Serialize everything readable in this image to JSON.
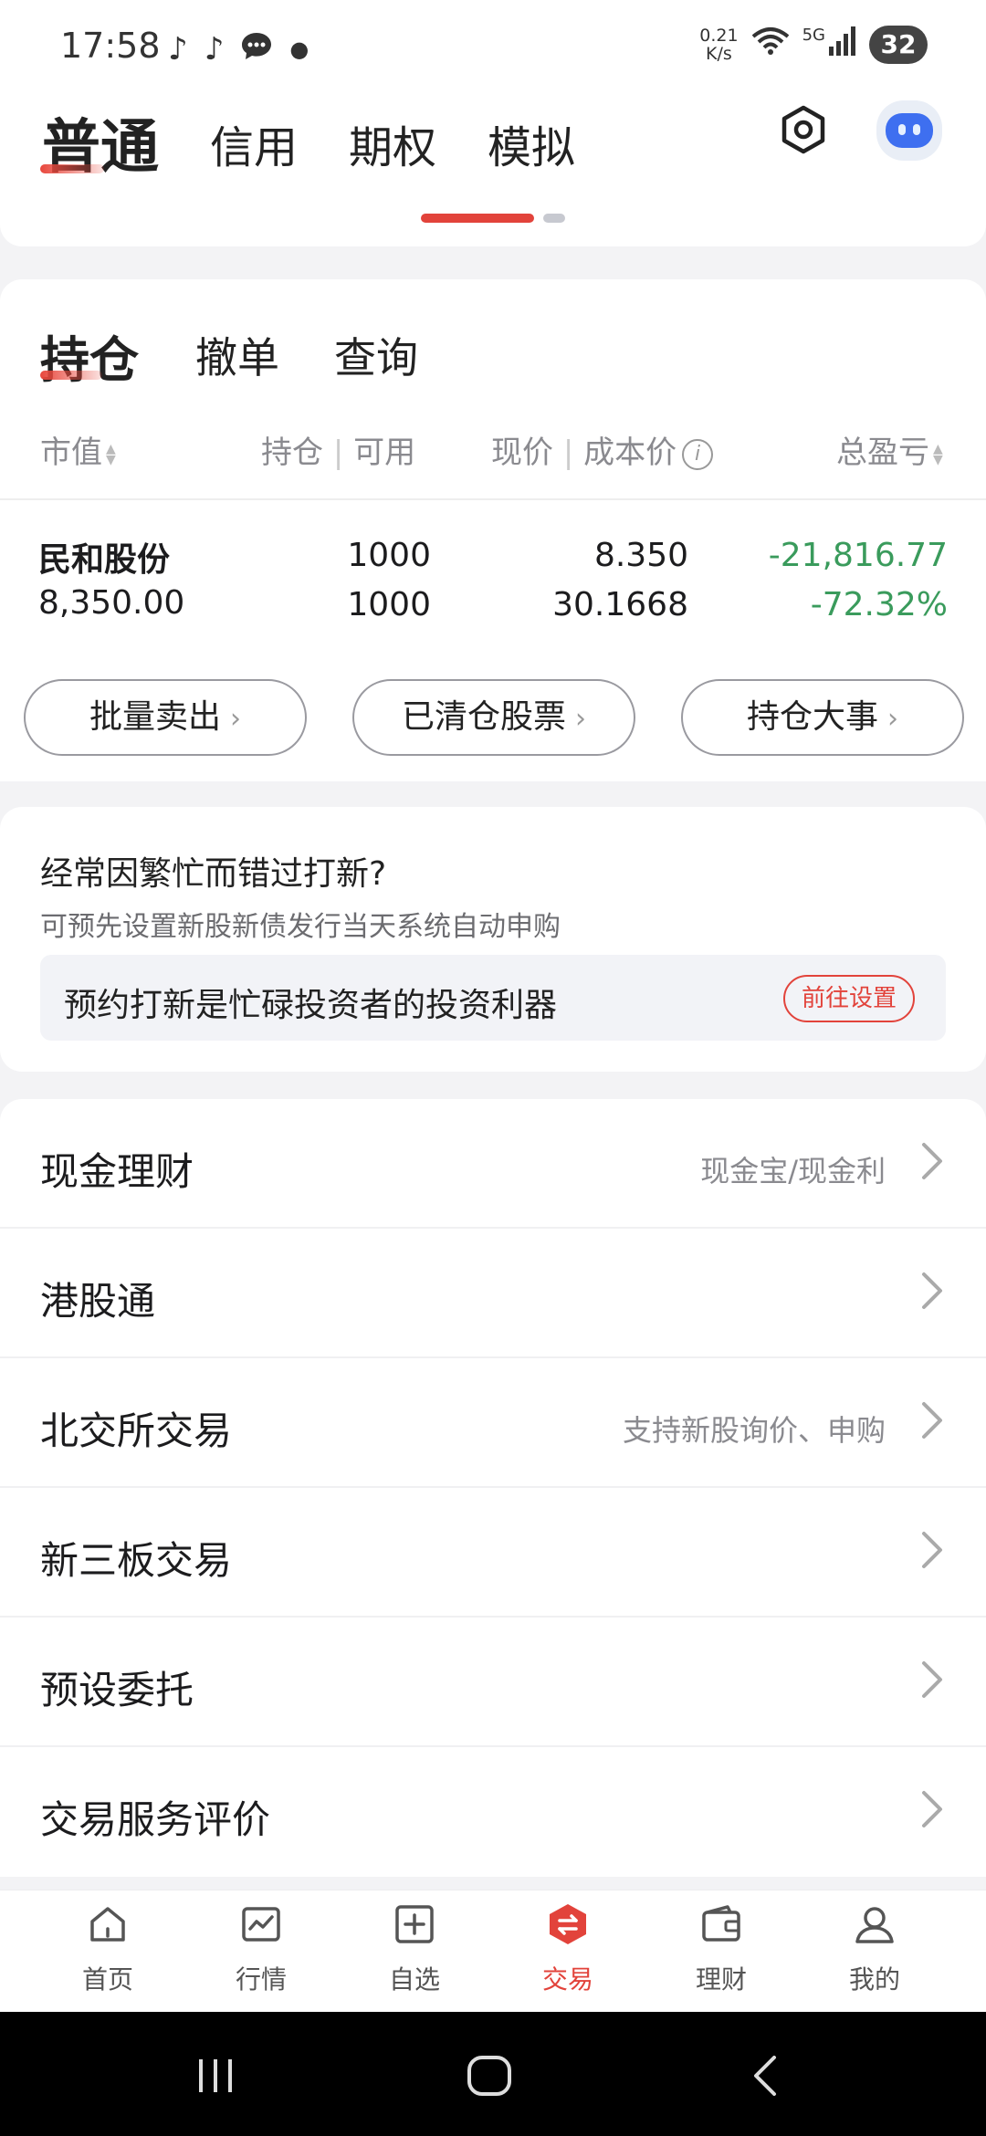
{
  "status_bar": {
    "time": "17:58",
    "notification_icons": [
      "tiktok-icon",
      "tiktok-icon",
      "message-icon",
      "dot-icon"
    ],
    "net_speed_value": "0.21",
    "net_speed_unit": "K/s",
    "network_label": "5G",
    "battery": "32"
  },
  "account_tabs": [
    {
      "label": "普通",
      "active": true
    },
    {
      "label": "信用",
      "active": false
    },
    {
      "label": "期权",
      "active": false
    },
    {
      "label": "模拟",
      "active": false
    }
  ],
  "position_tabs": [
    {
      "label": "持仓",
      "active": true
    },
    {
      "label": "撤单",
      "active": false
    },
    {
      "label": "查询",
      "active": false
    }
  ],
  "columns": {
    "market_value": "市值",
    "hold": "持仓",
    "hold_sep": "|",
    "available": "可用",
    "price": "现价",
    "price_sep": "|",
    "cost": "成本价",
    "info_glyph": "i",
    "pnl": "总盈亏"
  },
  "holdings": [
    {
      "name": "民和股份",
      "market_value": "8,350.00",
      "position": "1000",
      "available": "1000",
      "price": "8.350",
      "cost": "30.1668",
      "pnl": "-21,816.77",
      "pnl_pct": "-72.32%"
    }
  ],
  "actions": [
    {
      "label": "批量卖出"
    },
    {
      "label": "已清仓股票"
    },
    {
      "label": "持仓大事"
    }
  ],
  "ipo": {
    "title": "经常因繁忙而错过打新?",
    "subtitle": "可预先设置新股新债发行当天系统自动申购",
    "banner_text": "预约打新是忙碌投资者的投资利器",
    "button": "前往设置"
  },
  "menu": [
    {
      "label": "现金理财",
      "hint": "现金宝/现金利"
    },
    {
      "label": "港股通",
      "hint": ""
    },
    {
      "label": "北交所交易",
      "hint": "支持新股询价、申购"
    },
    {
      "label": "新三板交易",
      "hint": ""
    },
    {
      "label": "预设委托",
      "hint": ""
    },
    {
      "label": "交易服务评价",
      "hint": ""
    }
  ],
  "bottom_nav": [
    {
      "label": "首页",
      "icon": "home-icon",
      "active": false
    },
    {
      "label": "行情",
      "icon": "chart-icon",
      "active": false
    },
    {
      "label": "自选",
      "icon": "add-square-icon",
      "active": false
    },
    {
      "label": "交易",
      "icon": "trade-icon",
      "active": true
    },
    {
      "label": "理财",
      "icon": "wallet-icon",
      "active": false
    },
    {
      "label": "我的",
      "icon": "user-icon",
      "active": false
    }
  ],
  "colors": {
    "accent_red": "#e2433b",
    "loss_green": "#3a9b5c",
    "text_primary": "#1c1c1e",
    "text_secondary": "#8a8a8f",
    "background": "#f3f3f5"
  }
}
